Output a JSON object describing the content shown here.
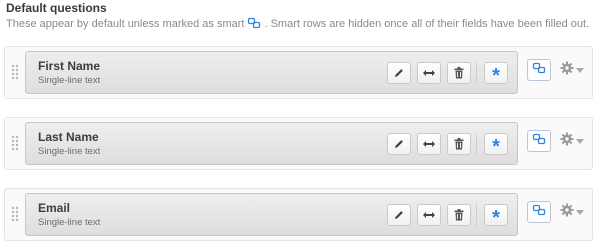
{
  "section": {
    "title": "Default questions",
    "description_before": "These appear by default unless marked as smart",
    "description_after": ". Smart rows are hidden once all of their fields have been filled out."
  },
  "questions": [
    {
      "label": "First Name",
      "type": "Single-line text"
    },
    {
      "label": "Last Name",
      "type": "Single-line text"
    },
    {
      "label": "Email",
      "type": "Single-line text"
    }
  ],
  "icons": {
    "drag": "drag-handle-icon",
    "edit": "pencil-icon",
    "width": "resize-horizontal-icon",
    "delete": "trash-icon",
    "required": "asterisk-icon",
    "smart": "smart-link-icon",
    "settings": "gear-icon"
  },
  "colors": {
    "required_star": "#2f83e0",
    "smart_icon": "#2f83e0"
  }
}
